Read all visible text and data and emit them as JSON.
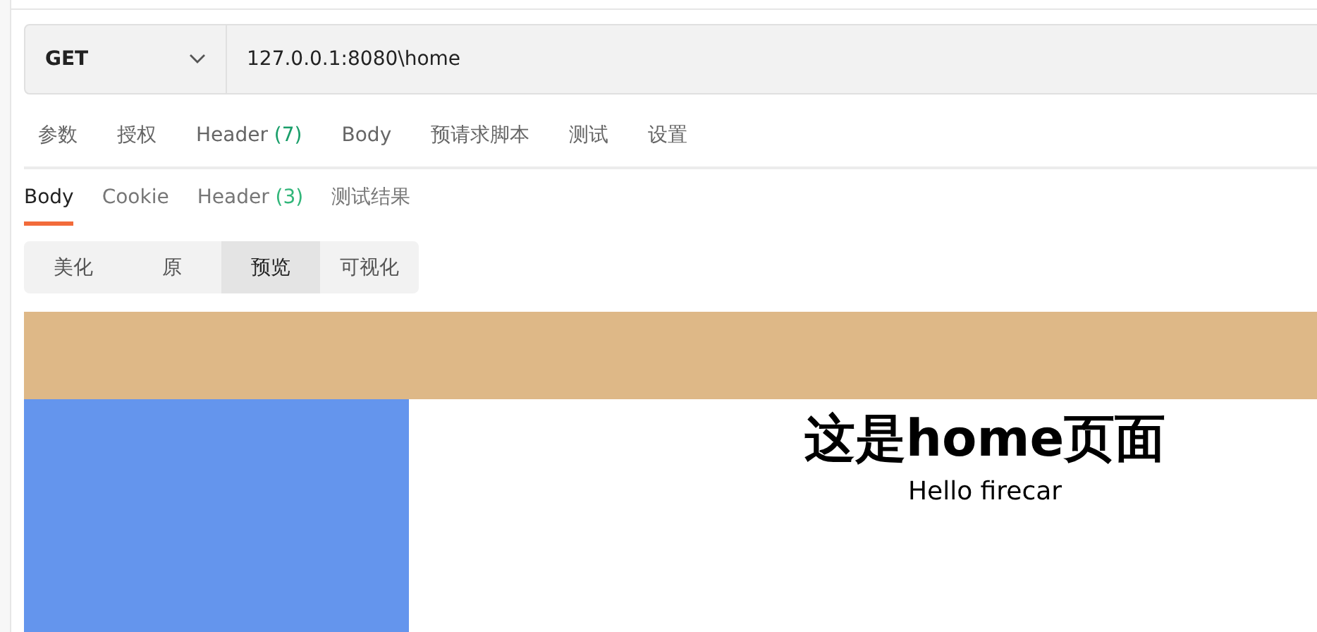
{
  "request": {
    "method": "GET",
    "url": "127.0.0.1:8080\\home"
  },
  "request_tabs": [
    {
      "label": "参数",
      "selected": false
    },
    {
      "label": "授权",
      "selected": false
    },
    {
      "label": "Header",
      "count": "(7)",
      "selected": false
    },
    {
      "label": "Body",
      "selected": false
    },
    {
      "label": "预请求脚本",
      "selected": false
    },
    {
      "label": "测试",
      "selected": false
    },
    {
      "label": "设置",
      "selected": false
    }
  ],
  "response_tabs": [
    {
      "label": "Body",
      "selected": true
    },
    {
      "label": "Cookie",
      "selected": false
    },
    {
      "label": "Header",
      "count": "(3)",
      "selected": false
    },
    {
      "label": "测试结果",
      "selected": false
    }
  ],
  "view_modes": [
    {
      "label": "美化",
      "selected": false
    },
    {
      "label": "原",
      "selected": false
    },
    {
      "label": "预览",
      "selected": true
    },
    {
      "label": "可视化",
      "selected": false
    }
  ],
  "preview": {
    "heading": "这是home页面",
    "text": "Hello firecar"
  }
}
